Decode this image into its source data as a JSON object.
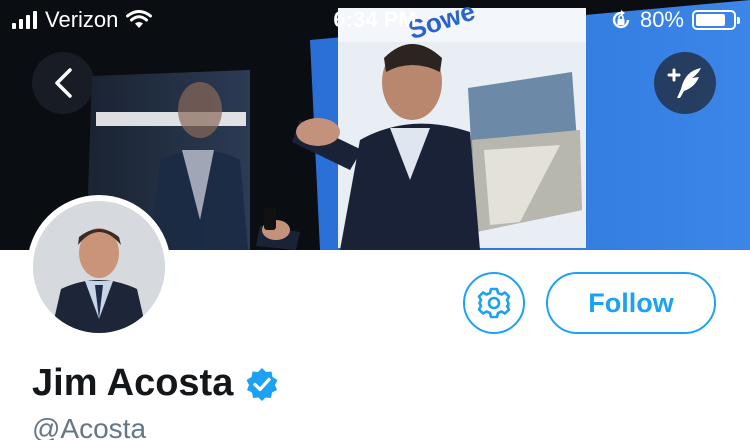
{
  "status_bar": {
    "carrier": "Verizon",
    "time": "6:34 PM",
    "battery_percent": "80%",
    "battery_level": 0.8,
    "icons": [
      "signal-icon",
      "wifi-icon",
      "orientation-lock-icon",
      "battery-icon"
    ]
  },
  "header": {
    "cover_slide_text": "Sowe"
  },
  "profile": {
    "display_name": "Jim Acosta",
    "handle": "@Acosta",
    "verified": true
  },
  "actions": {
    "follow_label": "Follow"
  },
  "colors": {
    "accent": "#1da1f2",
    "name": "#14171a",
    "handle": "#657786",
    "verified_badge": "#1da1f2"
  }
}
